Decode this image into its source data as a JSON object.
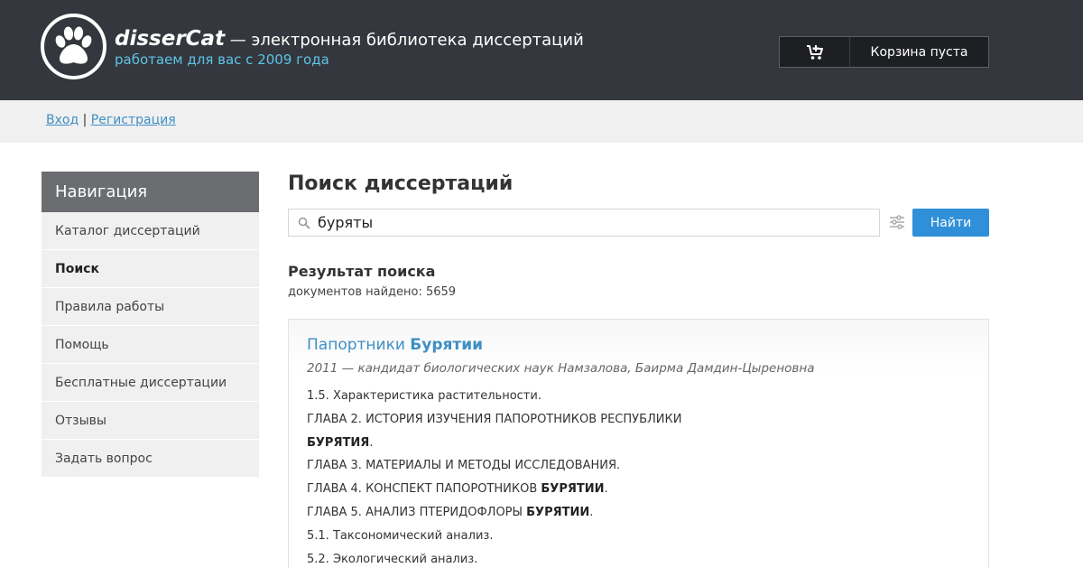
{
  "header": {
    "brand": "disserCat",
    "brand_rest": " — электронная библиотека диссертаций",
    "tagline": "работаем для вас с 2009 года",
    "cart_label": "Корзина пуста"
  },
  "auth": {
    "login": "Вход",
    "separator": " | ",
    "register": "Регистрация"
  },
  "nav": {
    "title": "Навигация",
    "items": [
      {
        "label": "Каталог диссертаций"
      },
      {
        "label": "Поиск"
      },
      {
        "label": "Правила работы"
      },
      {
        "label": "Помощь"
      },
      {
        "label": "Бесплатные диссертации"
      },
      {
        "label": "Отзывы"
      },
      {
        "label": "Задать вопрос"
      }
    ]
  },
  "search": {
    "title": "Поиск диссертаций",
    "query": "буряты",
    "button": "Найти"
  },
  "results": {
    "title": "Результат поиска",
    "count": "документов найдено: 5659",
    "first": {
      "title_plain": "Папортники ",
      "title_bold": "Бурятии",
      "meta": "2011 — кандидат биологических наук Намзалова, Баирма Дамдин-Цыреновна",
      "lines": [
        {
          "text": "1.5. Характеристика растительности.",
          "bold": ""
        },
        {
          "text": "ГЛАВА 2. ИСТОРИЯ ИЗУЧЕНИЯ ПАПОРОТНИКОВ РЕСПУБЛИКИ",
          "bold": ""
        },
        {
          "text": "",
          "bold": "БУРЯТИЯ",
          "after": "."
        },
        {
          "text": "ГЛАВА 3. МАТЕРИАЛЫ И МЕТОДЫ ИССЛЕДОВАНИЯ.",
          "bold": ""
        },
        {
          "text": "ГЛАВА 4. КОНСПЕКТ ПАПОРОТНИКОВ ",
          "bold": "БУРЯТИИ",
          "after": "."
        },
        {
          "text": "ГЛАВА 5. АНАЛИЗ ПТЕРИДОФЛОРЫ ",
          "bold": "БУРЯТИИ",
          "after": "."
        },
        {
          "text": "5.1. Таксономический анализ.",
          "bold": ""
        },
        {
          "text": "5.2. Экологический анализ.",
          "bold": ""
        }
      ]
    }
  },
  "colors": {
    "header_bg": "#34373d",
    "accent": "#3e8fc5",
    "button": "#2f8fd8",
    "tagline": "#5ec4e6"
  },
  "icons": {
    "logo": "paw-icon",
    "cart": "cart-icon",
    "search": "search-icon",
    "filter": "filter-sliders-icon"
  }
}
